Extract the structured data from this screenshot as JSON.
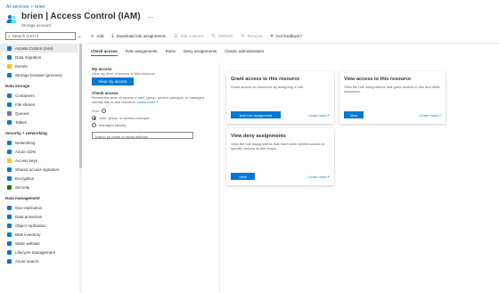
{
  "breadcrumb": {
    "root": "All services",
    "sep": ">",
    "current": "brien"
  },
  "header": {
    "title": "brien | Access Control (IAM)",
    "subtitle": "Storage account",
    "more": "..."
  },
  "search": {
    "placeholder": "Search (Ctrl+/)",
    "collapse": "«"
  },
  "sidebar": {
    "top": [
      {
        "label": "Access Control (IAM)",
        "icon_color": "#0078d4",
        "selected": true
      },
      {
        "label": "Data migration",
        "icon_color": "#0078d4"
      },
      {
        "label": "Events",
        "icon_color": "#f2c811"
      },
      {
        "label": "Storage browser (preview)",
        "icon_color": "#0078d4"
      }
    ],
    "sections": [
      {
        "title": "Data storage",
        "items": [
          {
            "label": "Containers",
            "icon_color": "#0078d4"
          },
          {
            "label": "File shares",
            "icon_color": "#0078d4"
          },
          {
            "label": "Queues",
            "icon_color": "#8764b8"
          },
          {
            "label": "Tables",
            "icon_color": "#0078d4"
          }
        ]
      },
      {
        "title": "Security + networking",
        "items": [
          {
            "label": "Networking",
            "icon_color": "#0078d4"
          },
          {
            "label": "Azure CDN",
            "icon_color": "#0078d4"
          },
          {
            "label": "Access keys",
            "icon_color": "#f2c811"
          },
          {
            "label": "Shared access signature",
            "icon_color": "#0078d4"
          },
          {
            "label": "Encryption",
            "icon_color": "#0078d4"
          },
          {
            "label": "Security",
            "icon_color": "#107c10"
          }
        ]
      },
      {
        "title": "Data management",
        "items": [
          {
            "label": "Geo-replication",
            "icon_color": "#0078d4"
          },
          {
            "label": "Data protection",
            "icon_color": "#0078d4"
          },
          {
            "label": "Object replication",
            "icon_color": "#0078d4"
          },
          {
            "label": "Blob inventory",
            "icon_color": "#0078d4"
          },
          {
            "label": "Static website",
            "icon_color": "#0078d4"
          },
          {
            "label": "Lifecycle management",
            "icon_color": "#0078d4"
          },
          {
            "label": "Azure search",
            "icon_color": "#0078d4"
          }
        ]
      }
    ]
  },
  "toolbar": {
    "add": "Add",
    "download": "Download role assignments",
    "edit_columns": "Edit columns",
    "refresh": "Refresh",
    "remove": "Remove",
    "feedback": "Got feedback?"
  },
  "tabs": [
    "Check access",
    "Role assignments",
    "Roles",
    "Deny assignments",
    "Classic administrators"
  ],
  "my_access": {
    "heading": "My access",
    "desc": "View my level of access to this resource.",
    "button": "View my access"
  },
  "check_access": {
    "heading": "Check access",
    "desc": "Review the level of access a user, group, service principal, or managed identity has to this resource.",
    "learn_more": "Learn more",
    "find_label": "Find",
    "info": "i",
    "options": [
      "User, group, or service principal",
      "Managed identity"
    ],
    "search_placeholder": "Search by name or email address"
  },
  "cards": {
    "grant": {
      "title": "Grant access to this resource",
      "desc": "Grant access to resources by assigning a role.",
      "button": "Add role assignment",
      "link": "Learn more"
    },
    "view_access": {
      "title": "View access to this resource",
      "desc": "View the role assignments that grant access to this and other resources.",
      "button": "View",
      "link": "Learn more"
    },
    "deny": {
      "title": "View deny assignments",
      "desc": "View the role assignments that have been denied access to specific actions at this scope.",
      "button": "View",
      "link": "Learn more"
    }
  }
}
